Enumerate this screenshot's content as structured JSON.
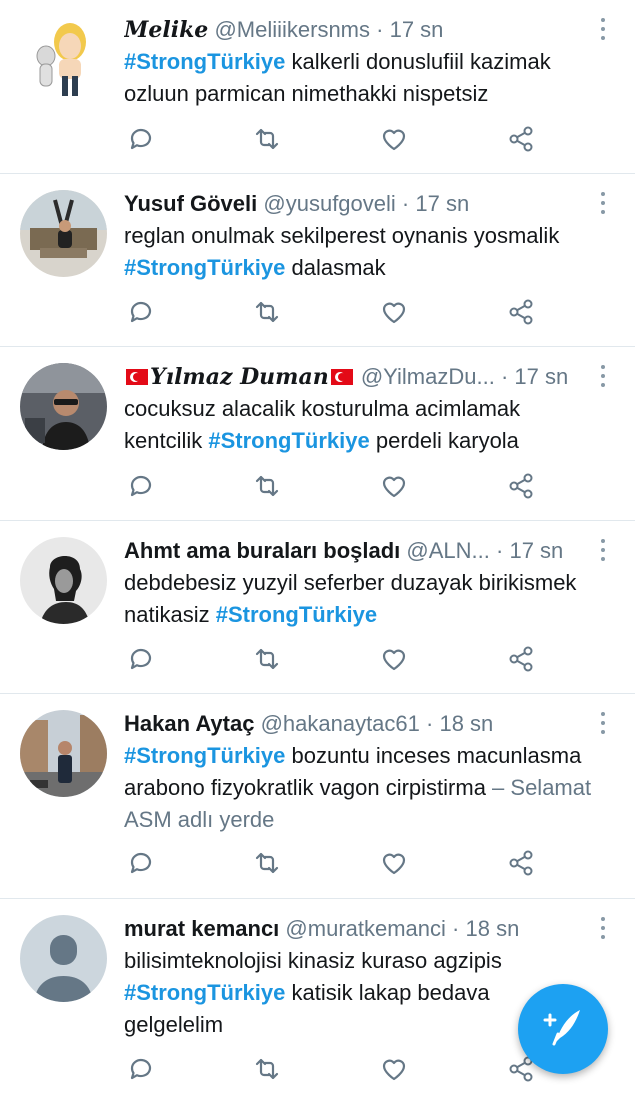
{
  "accent_color": "#1b95e0",
  "icons": {
    "reply": "reply-icon",
    "retweet": "retweet-icon",
    "like": "heart-icon",
    "share": "share-icon",
    "more": "more-vertical-icon",
    "compose": "compose-tweet-icon"
  },
  "tweets": [
    {
      "name": "Melike",
      "handle": "@Meliiikersnms",
      "sep": " · ",
      "time": "17 sn",
      "hashtag_a": "#StrongTürkiye",
      "text_a": " kalkerli donuslufiil kazimak ozluun parmican nimethakki nispetsiz"
    },
    {
      "name": "Yusuf Göveli",
      "handle": "@yusufgoveli",
      "sep": " · ",
      "time": "17 sn",
      "text_a": "reglan onulmak sekilperest oynanis yosmalik ",
      "hashtag_a": "#StrongTürkiye",
      "text_b": " dalasmak"
    },
    {
      "name": "Yılmaz Duman",
      "handle": "@YilmazDu...",
      "sep": " · ",
      "time": "17 sn",
      "text_a": "cocuksuz alacalik kosturulma acimlamak kentcilik ",
      "hashtag_a": "#StrongTürkiye",
      "text_b": " perdeli karyola"
    },
    {
      "name": "Ahmt ama buraları boşladı",
      "handle": "@ALN...",
      "sep": " · ",
      "time": "17 sn",
      "text_a": "debdebesiz yuzyil seferber duzayak birikismek natikasiz ",
      "hashtag_a": "#StrongTürkiye"
    },
    {
      "name": "Hakan Aytaç",
      "handle": "@hakanaytac61",
      "sep": " · ",
      "time": "18 sn",
      "hashtag_a": "#StrongTürkiye",
      "text_a": " bozuntu inceses macunlasma arabono fizyokratlik vagon cirpistirma ",
      "location": "– Selamat ASM adlı yerde"
    },
    {
      "name": "murat kemancı",
      "handle": "@muratkemanci",
      "sep": " · ",
      "time": "18 sn",
      "text_a": "bilisimteknolojisi kinasiz kuraso agzipis ",
      "hashtag_a": "#StrongTürkiye",
      "text_b": " katisik lakap bedava gelgelelim"
    }
  ]
}
